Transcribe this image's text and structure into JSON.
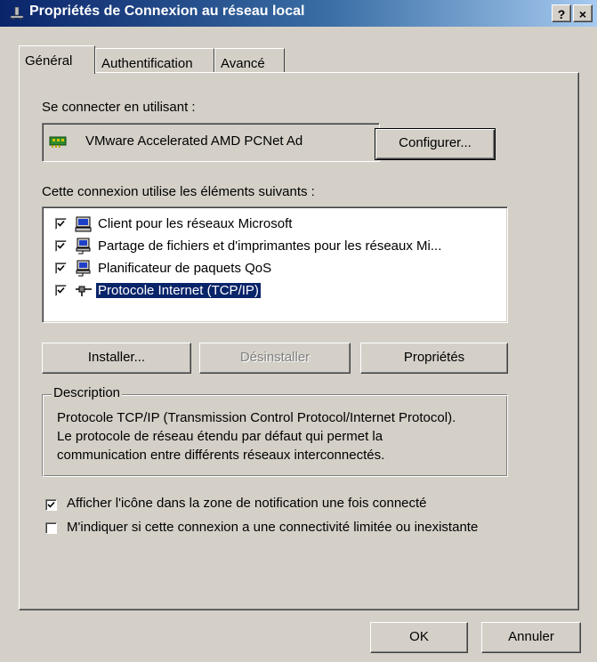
{
  "window": {
    "title": "Propriétés de Connexion au réseau local",
    "help_label": "?",
    "close_label": "×"
  },
  "tabs": [
    {
      "label": "Général",
      "active": true
    },
    {
      "label": "Authentification",
      "active": false
    },
    {
      "label": "Avancé",
      "active": false
    }
  ],
  "connect_using": {
    "label": "Se connecter en utilisant :",
    "adapter": "VMware Accelerated AMD PCNet Ad",
    "adapter_icon": "network-card-icon",
    "configure_button": "Configurer..."
  },
  "components": {
    "label": "Cette connexion utilise les éléments suivants :",
    "items": [
      {
        "label": "Client pour les réseaux Microsoft",
        "checked": true,
        "icon": "network-client-icon",
        "selected": false
      },
      {
        "label": "Partage de fichiers et d'imprimantes pour les réseaux Mi...",
        "checked": true,
        "icon": "network-service-icon",
        "selected": false
      },
      {
        "label": "Planificateur de paquets QoS",
        "checked": true,
        "icon": "network-service-icon",
        "selected": false
      },
      {
        "label": "Protocole Internet (TCP/IP)",
        "checked": true,
        "icon": "network-protocol-icon",
        "selected": true
      }
    ],
    "install_button": "Installer...",
    "uninstall_button": "Désinstaller",
    "properties_button": "Propriétés"
  },
  "description": {
    "title": "Description",
    "text": "Protocole TCP/IP (Transmission Control Protocol/Internet Protocol). Le protocole de réseau étendu par défaut qui permet la communication entre différents réseaux interconnectés."
  },
  "options": {
    "show_icon": {
      "label": "Afficher l'icône dans la zone de notification une fois connecté",
      "checked": true
    },
    "notify_limited": {
      "label": "M'indiquer si cette connexion a une connectivité limitée ou inexistante",
      "checked": false
    }
  },
  "footer": {
    "ok_button": "OK",
    "cancel_button": "Annuler"
  },
  "colors": {
    "selection": "#0a246a",
    "face": "#d4d0c8",
    "title_start": "#0a246a",
    "title_end": "#a6caf0"
  }
}
